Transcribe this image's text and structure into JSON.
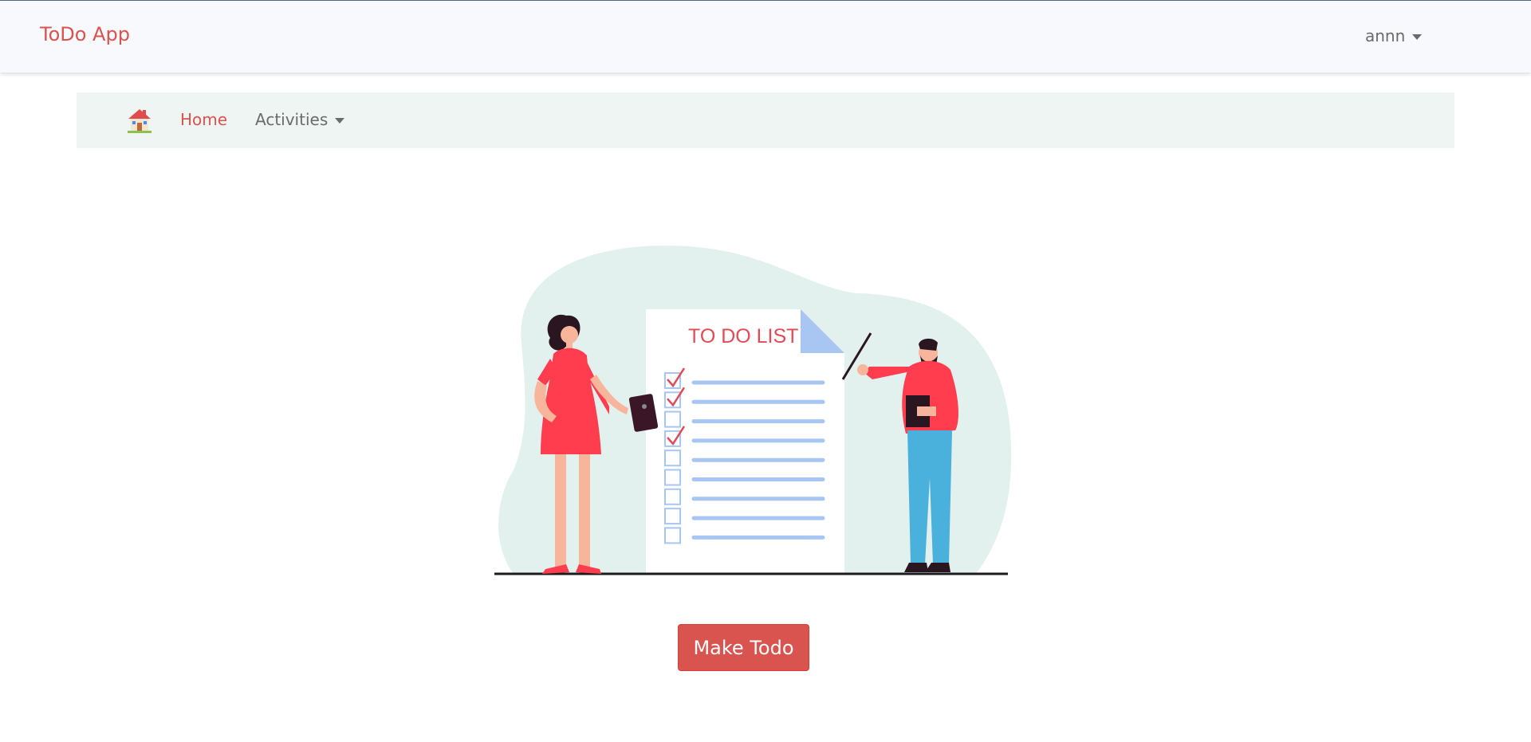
{
  "navbar": {
    "brand": "ToDo App",
    "user_name": "annn"
  },
  "subnav": {
    "home_icon": "house-icon",
    "home_label": "Home",
    "activities_label": "Activities"
  },
  "illustration": {
    "list_title": "TO DO LIST",
    "checkbox_states": [
      true,
      true,
      false,
      true,
      false,
      false,
      false,
      false,
      false
    ]
  },
  "main": {
    "make_todo_label": "Make Todo"
  },
  "colors": {
    "accent": "#d9534f",
    "nav_background": "#eef5f3",
    "topbar_background": "#f7f9fc",
    "line_blue": "#a8c6f4"
  }
}
